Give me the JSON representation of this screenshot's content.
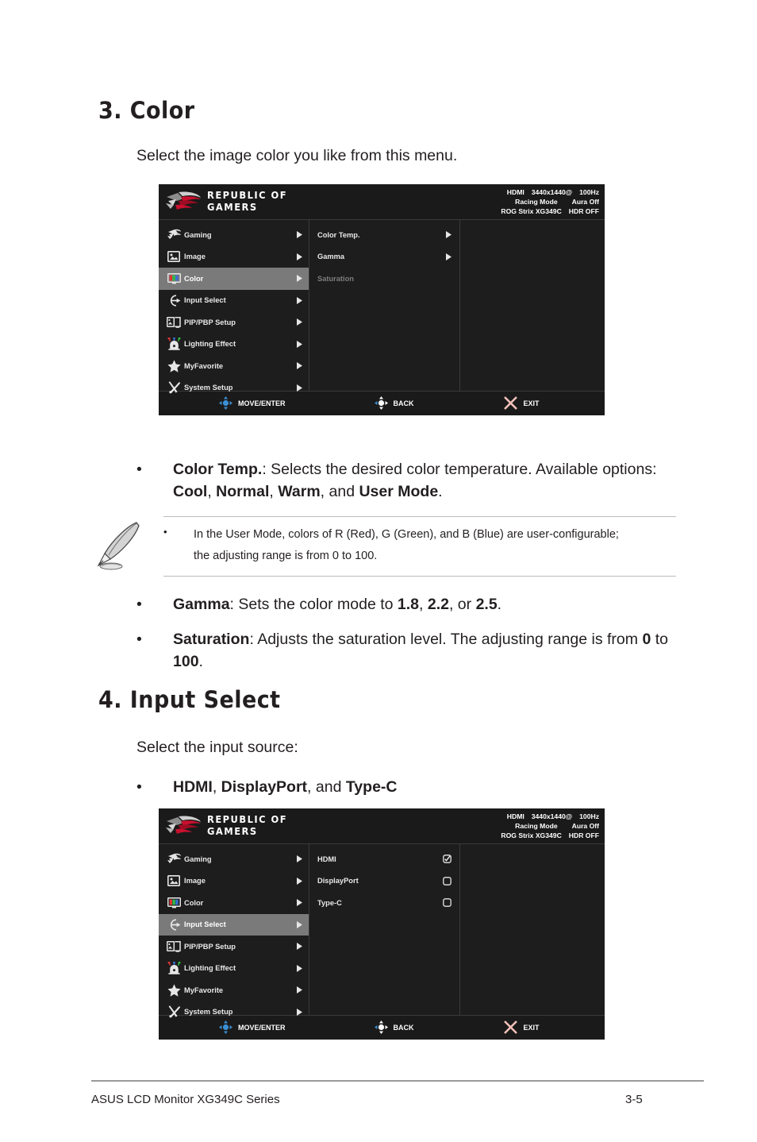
{
  "sections": {
    "color": {
      "heading": "3. Color",
      "intro": "Select the image color you like from this menu.",
      "bullets": [
        {
          "dot": "•",
          "parts": [
            {
              "t": "Color Temp.",
              "b": true
            },
            {
              "t": ": Selects the desired color temperature. Available options: ",
              "b": false
            },
            {
              "t": "Cool",
              "b": true
            },
            {
              "t": ", ",
              "b": false
            },
            {
              "t": "Normal",
              "b": true
            },
            {
              "t": ", ",
              "b": false
            },
            {
              "t": "Warm",
              "b": true
            },
            {
              "t": ", and ",
              "b": false
            },
            {
              "t": "User Mode",
              "b": true
            },
            {
              "t": ".",
              "b": false
            }
          ]
        },
        {
          "dot": "•",
          "parts": [
            {
              "t": "Gamma",
              "b": true
            },
            {
              "t": ": Sets the color mode to ",
              "b": false
            },
            {
              "t": "1.8",
              "b": true
            },
            {
              "t": ", ",
              "b": false
            },
            {
              "t": "2.2",
              "b": true
            },
            {
              "t": ", or ",
              "b": false
            },
            {
              "t": "2.5",
              "b": true
            },
            {
              "t": ".",
              "b": false
            }
          ]
        },
        {
          "dot": "•",
          "parts": [
            {
              "t": "Saturation",
              "b": true
            },
            {
              "t": ": Adjusts the saturation level. The adjusting range is from ",
              "b": false
            },
            {
              "t": "0",
              "b": true
            },
            {
              "t": " to ",
              "b": false
            },
            {
              "t": "100",
              "b": true
            },
            {
              "t": ".",
              "b": false
            }
          ]
        }
      ],
      "note": {
        "icon": "quill-pen-icon",
        "dot": "•",
        "line1": "In the User Mode, colors of R (Red), G (Green), and B (Blue) are user-configurable;",
        "line2": "the adjusting range is from 0 to 100."
      }
    },
    "input_select": {
      "heading": "4. Input Select",
      "intro": "Select the input source:",
      "bullets": [
        {
          "dot": "•",
          "parts": [
            {
              "t": "HDMI",
              "b": true
            },
            {
              "t": ", ",
              "b": false
            },
            {
              "t": "DisplayPort",
              "b": true
            },
            {
              "t": ", and ",
              "b": false
            },
            {
              "t": "Type-C",
              "b": true
            }
          ]
        }
      ]
    }
  },
  "osd": {
    "brand": {
      "line1": "REPUBLIC OF",
      "line2": "GAMERS",
      "logo_icon": "rog-eye-logo-icon"
    },
    "status": {
      "line1_a": "HDMI",
      "line1_b": "3440x1440@",
      "line1_c": "100Hz",
      "line2_a": "Racing Mode",
      "line2_b": "Aura Off",
      "line3_a": "ROG Strix XG349C",
      "line3_b": "HDR OFF"
    },
    "main_menu": [
      {
        "label": "Gaming",
        "icon": "rog-eye-icon",
        "arrow": true
      },
      {
        "label": "Image",
        "icon": "picture-icon",
        "arrow": true
      },
      {
        "label": "Color",
        "icon": "color-monitor-icon",
        "arrow": true
      },
      {
        "label": "Input Select",
        "icon": "input-arrow-icon",
        "arrow": true
      },
      {
        "label": "PIP/PBP Setup",
        "icon": "pip-pbp-icon",
        "arrow": true
      },
      {
        "label": "Lighting Effect",
        "icon": "lighting-lamp-icon",
        "arrow": true
      },
      {
        "label": "MyFavorite",
        "icon": "star-icon",
        "arrow": true
      },
      {
        "label": "System Setup",
        "icon": "wrench-screwdriver-icon",
        "arrow": true
      }
    ],
    "footer": {
      "move": {
        "label": "MOVE/ENTER",
        "icon": "joystick-blue-icon"
      },
      "back": {
        "label": "BACK",
        "icon": "joystick-white-left-icon"
      },
      "exit": {
        "label": "EXIT",
        "icon": "close-x-icon"
      }
    },
    "menu_color": {
      "active_index": 2,
      "submenu": [
        {
          "label": "Color Temp.",
          "arrow": true,
          "disabled": false
        },
        {
          "label": "Gamma",
          "arrow": true,
          "disabled": false
        },
        {
          "label": "Saturation",
          "arrow": false,
          "disabled": true
        }
      ]
    },
    "menu_input": {
      "active_index": 3,
      "submenu": [
        {
          "label": "HDMI",
          "checked": true
        },
        {
          "label": "DisplayPort",
          "checked": false
        },
        {
          "label": "Type-C",
          "checked": false
        }
      ]
    }
  },
  "page_footer": {
    "left": "ASUS LCD Monitor XG349C Series",
    "right": "3-5"
  },
  "colors": {
    "osd_bg": "#1d1d1d",
    "osd_header_bg": "#1a1a1a",
    "highlight": "#7a7a7a",
    "accent_blue": "#3b8fd4",
    "exit_pink": "#f0c0b8",
    "rog_red": "#c8102e"
  }
}
